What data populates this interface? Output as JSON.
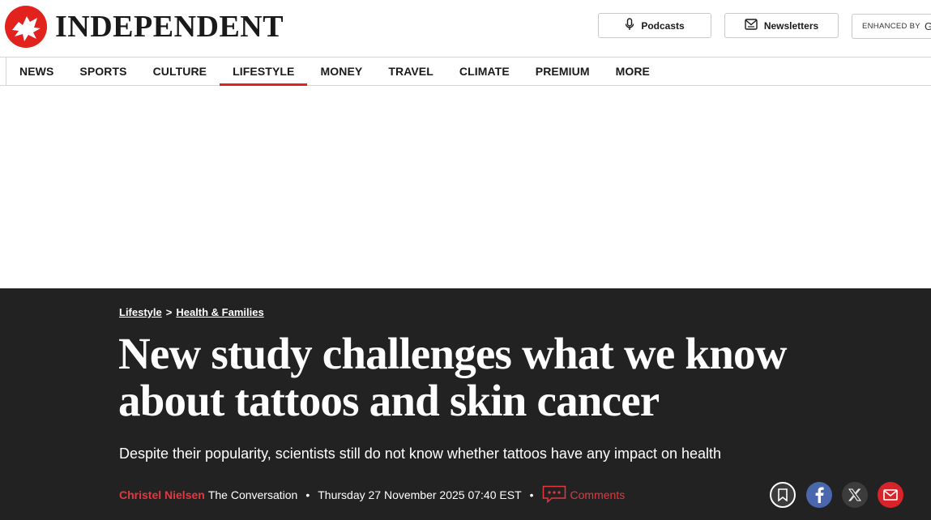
{
  "masthead": {
    "logo_text": "INDEPENDENT",
    "podcasts_label": "Podcasts",
    "newsletters_label": "Newsletters",
    "search_label": "ENHANCED BY",
    "search_brand_glyph": "G"
  },
  "nav": {
    "items": [
      {
        "label": "NEWS"
      },
      {
        "label": "SPORTS"
      },
      {
        "label": "CULTURE"
      },
      {
        "label": "LIFESTYLE",
        "active": true
      },
      {
        "label": "MONEY"
      },
      {
        "label": "TRAVEL"
      },
      {
        "label": "CLIMATE"
      },
      {
        "label": "PREMIUM"
      },
      {
        "label": "MORE"
      }
    ]
  },
  "article": {
    "breadcrumb": {
      "section": "Lifestyle",
      "separator": ">",
      "subsection": "Health & Families"
    },
    "headline": "New study challenges what we know about tattoos and skin cancer",
    "standfirst": "Despite their popularity, scientists still do not know whether tattoos have any impact on health",
    "byline": {
      "author": "Christel Nielsen",
      "organisation": "The Conversation",
      "separator": "•",
      "date": "Thursday 27 November 2025 07:40 EST",
      "comments_label": "Comments"
    },
    "share_icons": [
      "bookmark-icon",
      "facebook-icon",
      "x-icon",
      "email-icon"
    ]
  },
  "colors": {
    "brand_red": "#e1221d",
    "hero_background": "#222222",
    "author_red": "#e3383f",
    "facebook_blue": "#4a67ad",
    "email_red": "#d9232a"
  }
}
